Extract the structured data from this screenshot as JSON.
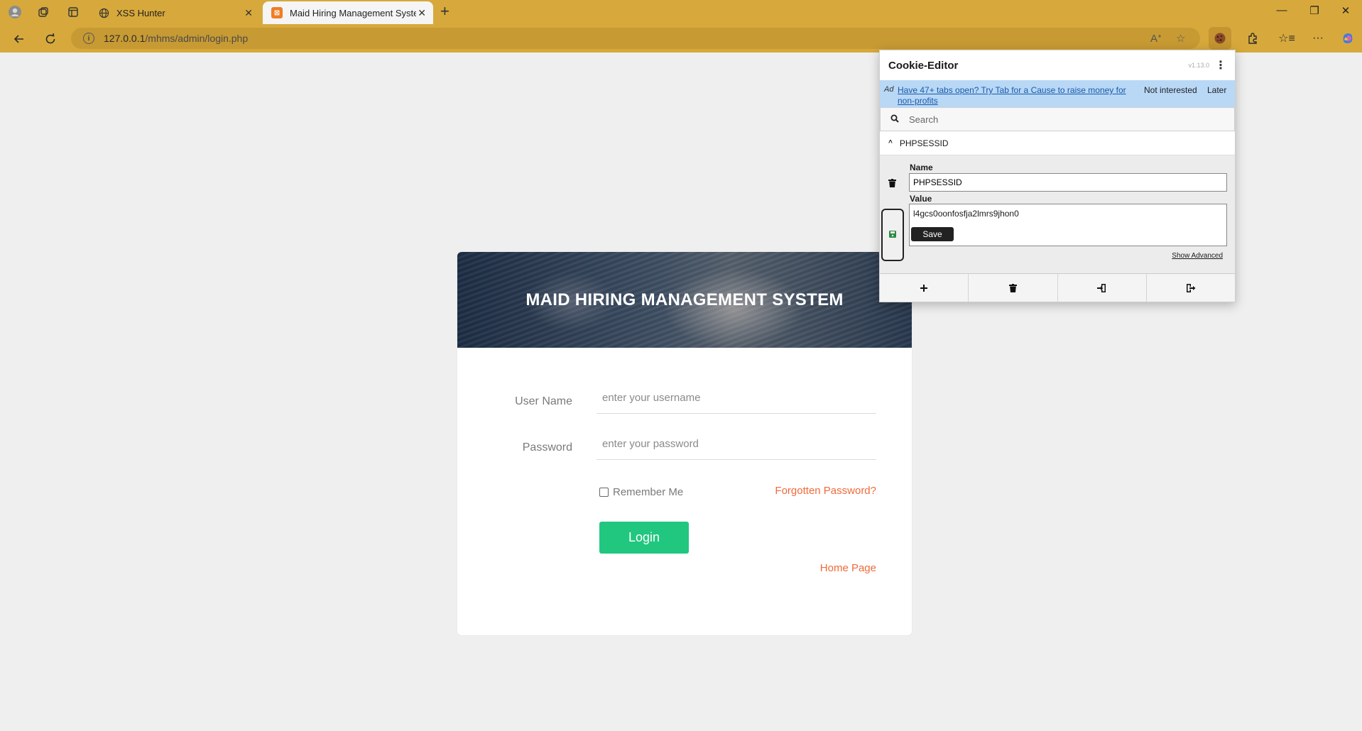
{
  "browser": {
    "tabs": [
      {
        "title": "XSS Hunter",
        "active": false
      },
      {
        "title": "Maid Hiring Management System",
        "active": true
      }
    ],
    "url_host": "127.0.0.1",
    "url_path": "/mhms/admin/login.php",
    "accent_color": "#d7a93c"
  },
  "login": {
    "header_title": "MAID HIRING MANAGEMENT SYSTEM",
    "username_label": "User Name",
    "username_placeholder": "enter your username",
    "password_label": "Password",
    "password_placeholder": "enter your password",
    "remember_label": "Remember Me",
    "forgot_label": "Forgotten Password?",
    "login_button": "Login",
    "home_link": "Home Page",
    "button_color": "#21c77f",
    "link_color": "#f06a3a"
  },
  "cookie_editor": {
    "title": "Cookie-Editor",
    "version": "v1.13.0",
    "ad_tag": "Ad",
    "ad_text": "Have 47+ tabs open? Try Tab for a Cause to raise money for non-profits",
    "ad_not_interested": "Not interested",
    "ad_later": "Later",
    "search_placeholder": "Search",
    "cookie_name": "PHPSESSID",
    "name_label": "Name",
    "name_value": "PHPSESSID",
    "value_label": "Value",
    "value_value": "l4gcs0oonfosfja2lmrs9jhon0",
    "save_button": "Save",
    "show_advanced": "Show Advanced",
    "actions": [
      "add-icon",
      "delete-all-icon",
      "import-icon",
      "export-icon"
    ]
  }
}
